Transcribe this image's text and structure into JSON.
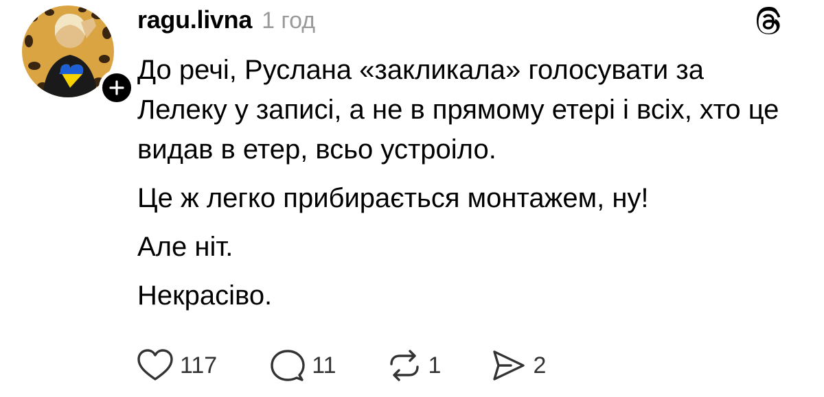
{
  "post": {
    "username": "ragu.livna",
    "time": "1 год",
    "paragraphs": [
      "До речі, Руслана «закликала» голосувати за Лелеку у записі, а не в прямому етері і всіх, хто це видав в етер, всьо устроіло.",
      "Це ж легко прибирається монтажем, ну!",
      "Але ніт.",
      "Некрасіво."
    ]
  },
  "actions": {
    "likes": "117",
    "replies": "11",
    "reposts": "1",
    "shares": "2"
  },
  "icons": {
    "avatar": "avatar-leopard-ukraine-heart",
    "follow": "plus-icon",
    "brand": "threads-logo-icon",
    "like": "heart-icon",
    "reply": "comment-bubble-icon",
    "repost": "repost-arrows-icon",
    "share": "send-icon"
  },
  "colors": {
    "text": "#000000",
    "muted": "#9a9a9a",
    "counts": "#333333",
    "badge": "#000000"
  }
}
